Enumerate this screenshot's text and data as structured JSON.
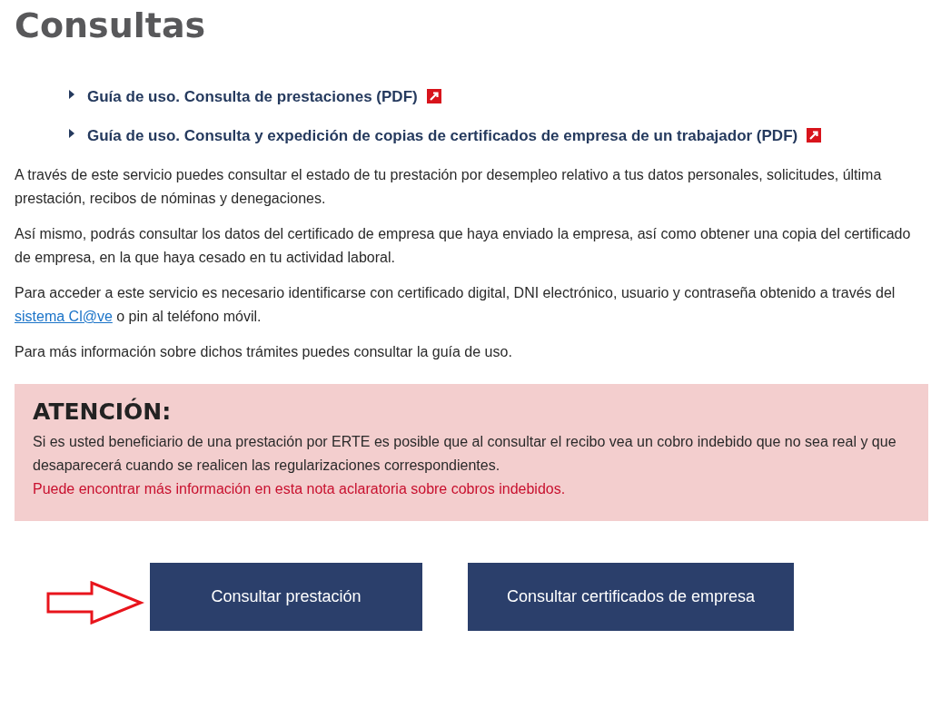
{
  "title": "Consultas",
  "guides": [
    {
      "label": "Guía de uso. Consulta de prestaciones (PDF)",
      "external": true
    },
    {
      "label": "Guía de uso. Consulta y expedición de copias de certificados de empresa de un trabajador (PDF)",
      "external": true
    }
  ],
  "paragraphs": [
    {
      "text": "A través de este servicio puedes consultar el estado de tu prestación por desempleo relativo a tus datos personales, solicitudes, última prestación, recibos de nóminas y denegaciones."
    },
    {
      "text": "Así mismo, podrás consultar los datos del certificado de empresa que haya enviado la empresa, así como obtener una copia del certificado de empresa, en la que haya cesado en tu actividad laboral."
    },
    {
      "text": "Para acceder a este servicio es necesario identificarse con certificado digital, DNI electrónico, usuario y contraseña obtenido a través del",
      "link": "sistema Cl@ve",
      "after": "o pin al teléfono móvil."
    },
    {
      "text": "Para más información sobre dichos trámites puedes consultar la guía de uso."
    }
  ],
  "alert": {
    "heading": "ATENCIÓN:",
    "body": "Si es usted beneficiario de una prestación por ERTE es posible que al consultar el recibo vea un cobro indebido que no sea real y que desaparecerá cuando se realicen las regularizaciones correspondientes.",
    "note": "Puede encontrar más información en esta nota aclaratoria sobre cobros indebidos."
  },
  "buttons": [
    {
      "label": "Consultar prestación",
      "pointed": true
    },
    {
      "label": "Consultar certificados de empresa",
      "pointed": false
    }
  ]
}
